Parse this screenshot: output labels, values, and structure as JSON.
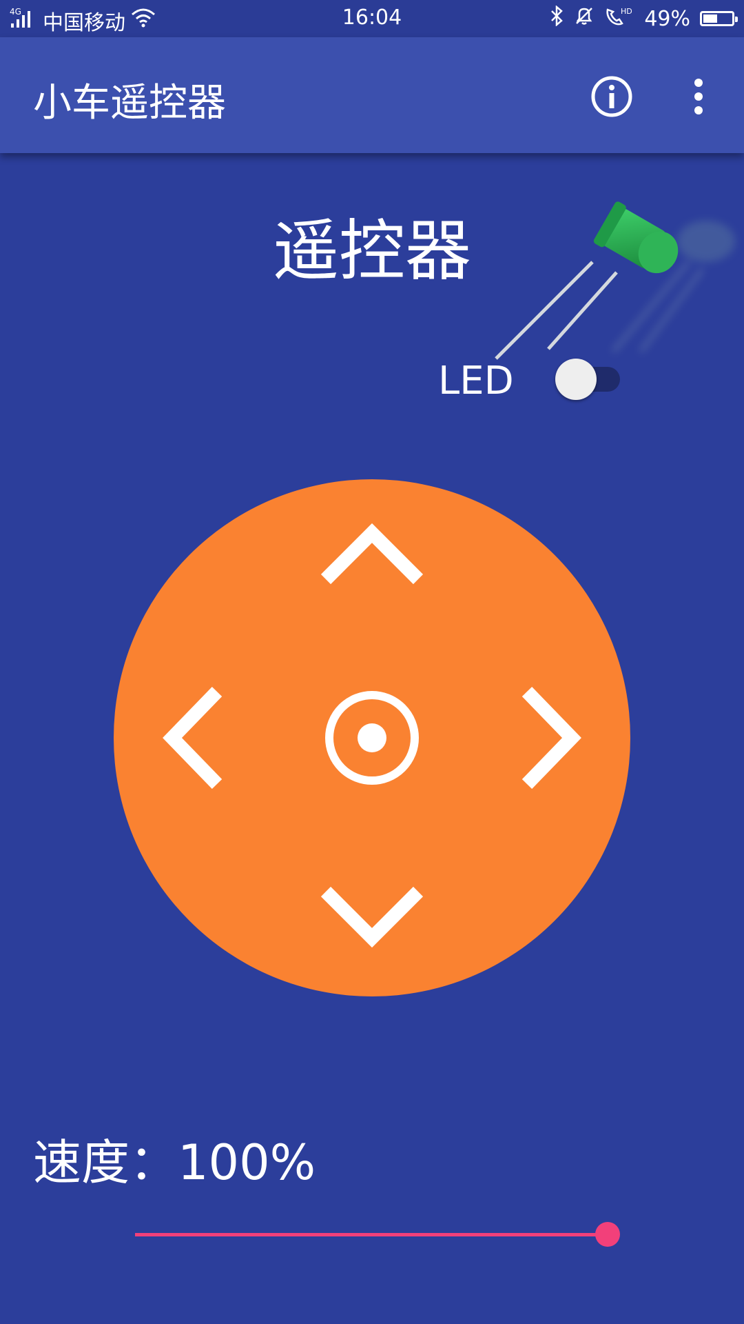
{
  "status_bar": {
    "network_label": "4G",
    "carrier": "中国移动",
    "time": "16:04",
    "battery_percent_text": "49%",
    "battery_level": 0.49,
    "icons": [
      "signal-icon",
      "wifi-icon",
      "bluetooth-icon",
      "alarm-icon",
      "hd-call-icon",
      "battery-icon"
    ]
  },
  "toolbar": {
    "title": "小车遥控器",
    "info_icon": "info-icon",
    "more_icon": "more-vertical-icon"
  },
  "main": {
    "title": "遥控器",
    "led": {
      "label": "LED",
      "enabled": false
    },
    "dpad": {
      "color": "#fa8231",
      "buttons": [
        "up-arrow-icon",
        "down-arrow-icon",
        "left-arrow-icon",
        "right-arrow-icon",
        "stop-center-icon"
      ]
    },
    "speed": {
      "label": "速度：100%",
      "value_percent": 100
    }
  },
  "colors": {
    "background": "#2c3e9b",
    "toolbar": "#3c50ae",
    "accent": "#f2407a",
    "dpad": "#fa8231"
  }
}
